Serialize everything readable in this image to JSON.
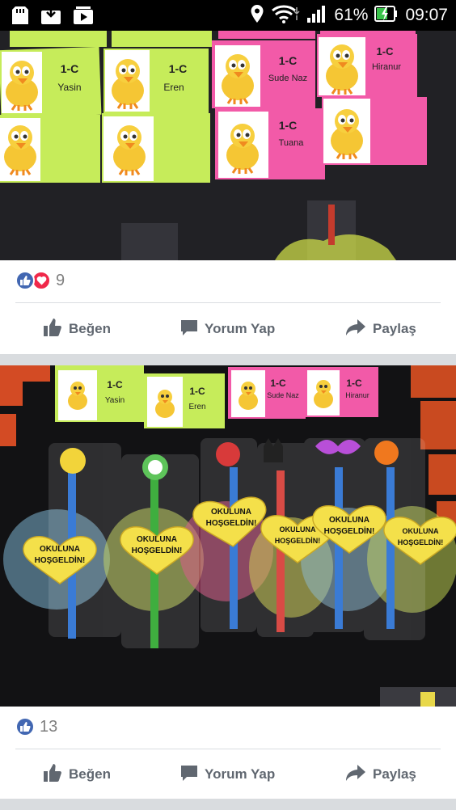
{
  "status_bar": {
    "battery_percent": "61%",
    "time": "09:07",
    "left_icons": [
      "sd-card-icon",
      "download-tray-icon",
      "media-play-icon"
    ],
    "right_icons": [
      "location-pin-icon",
      "wifi-icon",
      "signal-bars-icon",
      "battery-charging-icon"
    ]
  },
  "post1": {
    "photo": {
      "cards": [
        {
          "class_label": "1-C",
          "name": "Yasin",
          "color": "#c6ec5a"
        },
        {
          "class_label": "1-C",
          "name": "Eren",
          "color": "#c6ec5a"
        },
        {
          "class_label": "1-C",
          "name": "Sude Naz",
          "color": "#f25aa8"
        },
        {
          "class_label": "1-C",
          "name": "Hiranur",
          "color": "#f25aa8"
        },
        {
          "class_label": "",
          "name": "",
          "color": "#c6ec5a"
        },
        {
          "class_label": "",
          "name": "",
          "color": "#c6ec5a"
        },
        {
          "class_label": "1-C",
          "name": "Tuana",
          "color": "#f25aa8"
        },
        {
          "class_label": "",
          "name": "",
          "color": "#f25aa8"
        }
      ]
    },
    "reactions": {
      "count": "9",
      "types": [
        "like-icon",
        "love-icon"
      ]
    },
    "actions": {
      "like": "Beğen",
      "comment": "Yorum Yap",
      "share": "Paylaş"
    }
  },
  "post2": {
    "photo": {
      "top_cards": [
        {
          "class_label": "1-C",
          "name": "Yasin",
          "color": "#c6ec5a"
        },
        {
          "class_label": "1-C",
          "name": "Eren",
          "color": "#c6ec5a"
        },
        {
          "class_label": "1-C",
          "name": "Sude Naz",
          "color": "#f25aa8"
        },
        {
          "class_label": "1-C",
          "name": "Hiranur",
          "color": "#f25aa8"
        }
      ],
      "hearts": [
        {
          "line1": "OKULUNA",
          "line2": "HOŞGELDİN!"
        },
        {
          "line1": "OKULUNA",
          "line2": "HOŞGELDİN!"
        },
        {
          "line1": "OKULUNA",
          "line2": "HOŞGELDİN!"
        },
        {
          "line1": "OKULUNA",
          "line2": "HOŞGELDİN!"
        },
        {
          "line1": "OKULUNA",
          "line2": "HOŞGELDİN!"
        },
        {
          "line1": "OKULUNA",
          "line2": "HOŞGELDİN!"
        }
      ]
    },
    "reactions": {
      "count": "13",
      "types": [
        "like-icon"
      ]
    },
    "actions": {
      "like": "Beğen",
      "comment": "Yorum Yap",
      "share": "Paylaş"
    }
  },
  "colors": {
    "facebook_blue": "#4267b2",
    "love_red": "#f0284a",
    "action_gray": "#606770",
    "heart_yellow": "#f4e04a"
  }
}
